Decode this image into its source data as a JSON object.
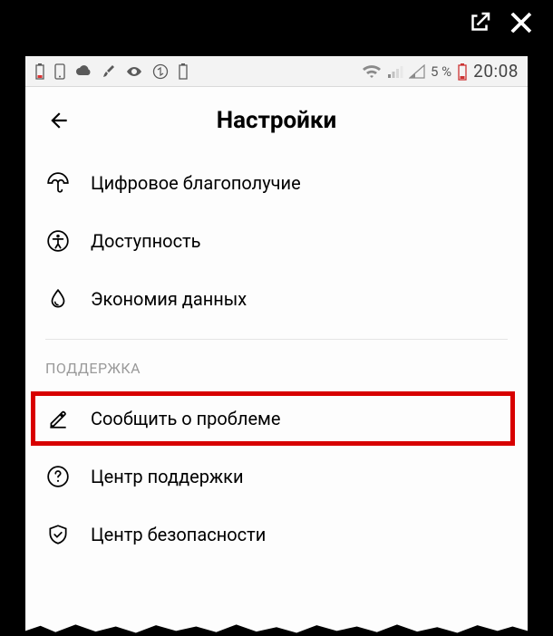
{
  "frame": {
    "open_external": "open-external",
    "close": "close"
  },
  "status_bar": {
    "battery_percent": "5 %",
    "time": "20:08"
  },
  "header": {
    "title": "Настройки"
  },
  "settings": {
    "items": [
      {
        "label": "Цифровое благополучие",
        "icon": "umbrella"
      },
      {
        "label": "Доступность",
        "icon": "accessibility"
      },
      {
        "label": "Экономия данных",
        "icon": "droplet"
      }
    ]
  },
  "support": {
    "section_label": "ПОДДЕРЖКА",
    "items": [
      {
        "label": "Сообщить о проблеме",
        "icon": "pencil-underline",
        "highlighted": true
      },
      {
        "label": "Центр поддержки",
        "icon": "help-circle",
        "highlighted": false
      },
      {
        "label": "Центр безопасности",
        "icon": "shield-check",
        "highlighted": false
      }
    ]
  }
}
